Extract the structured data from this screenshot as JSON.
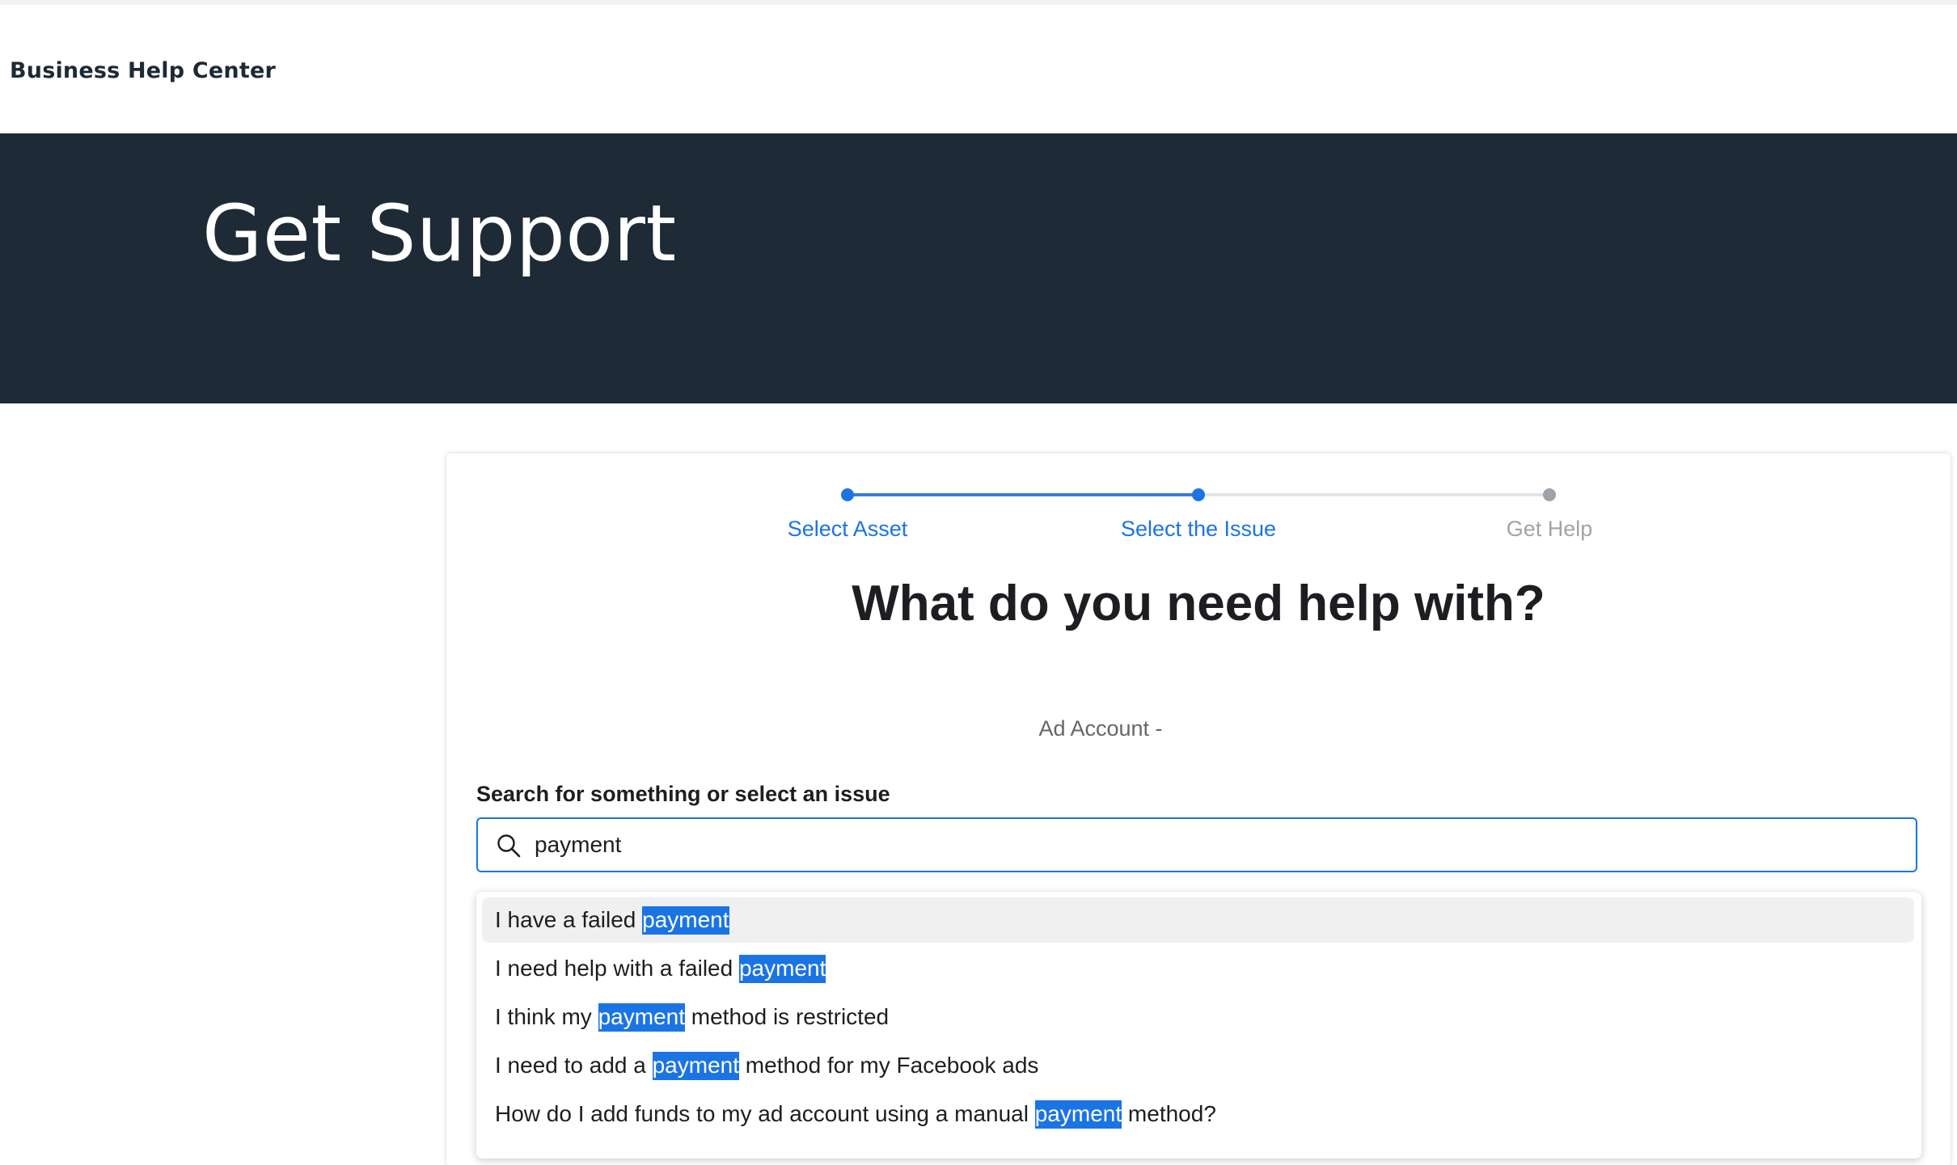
{
  "header": {
    "brand": "Business Help Center"
  },
  "hero": {
    "title": "Get Support"
  },
  "stepper": {
    "steps": [
      {
        "label": "Select Asset",
        "state": "complete"
      },
      {
        "label": "Select the Issue",
        "state": "current"
      },
      {
        "label": "Get Help",
        "state": "upcoming"
      }
    ],
    "colors": {
      "active": "#1b74e4",
      "inactive": "#9ea3a8"
    }
  },
  "main": {
    "question": "What do you need help with?",
    "ad_account": "Ad Account -",
    "search_label": "Search for something or select an issue",
    "search_value": "payment"
  },
  "dropdown": {
    "options": [
      {
        "before": "I have a failed ",
        "match": "payment",
        "after": ""
      },
      {
        "before": "I need help with a failed ",
        "match": "payment",
        "after": ""
      },
      {
        "before": "I think my ",
        "match": "payment",
        "after": " method is restricted"
      },
      {
        "before": "I need to add a ",
        "match": "payment",
        "after": " method for my Facebook ads"
      },
      {
        "before": "How do I add funds to my ad account using a manual ",
        "match": "payment",
        "after": " method?"
      }
    ],
    "highlight_color": "#1b74e4"
  }
}
